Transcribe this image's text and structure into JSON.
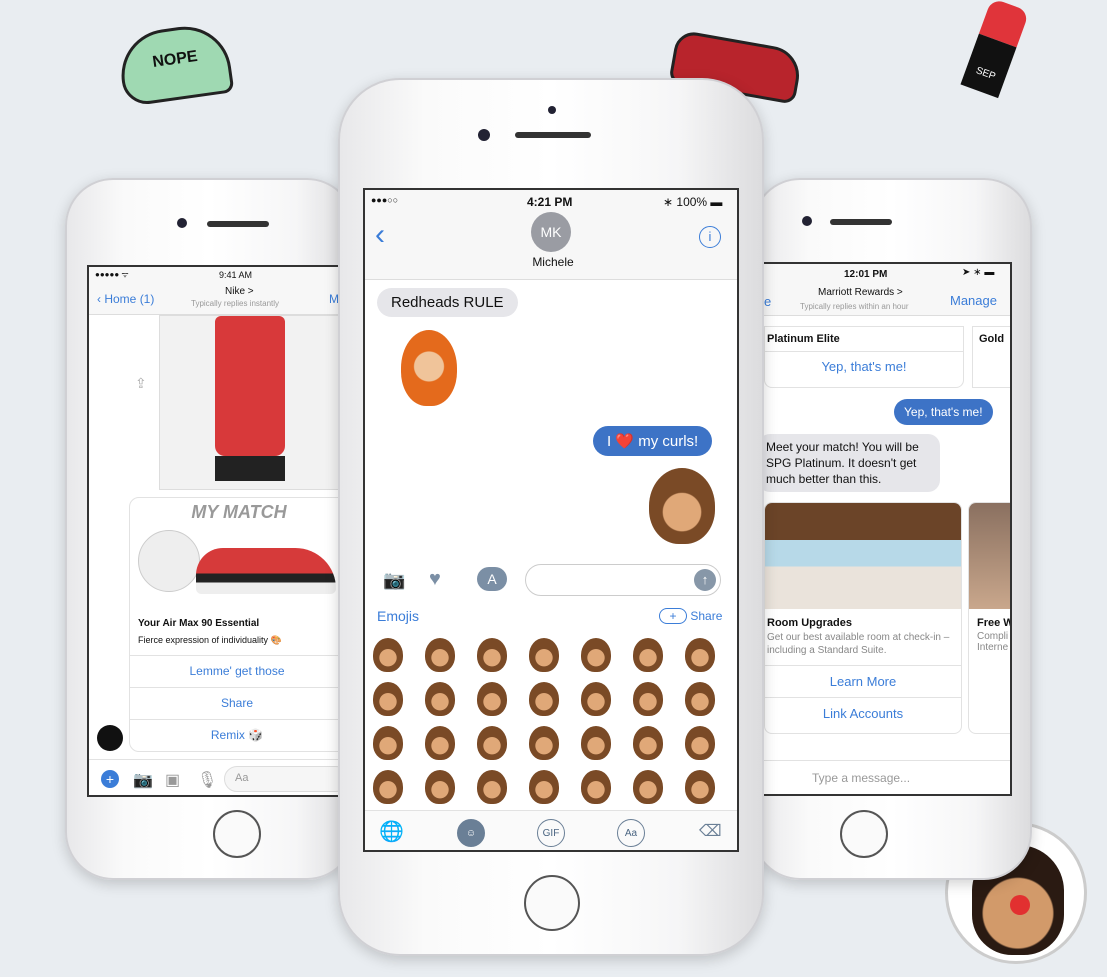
{
  "decor": {
    "cap_text": "NOPE",
    "lipstick_text": "SEP"
  },
  "left_phone": {
    "status": {
      "time": "9:41 AM"
    },
    "nav": {
      "back": "Home (1)",
      "title": "Nike >",
      "subtitle": "Typically replies instantly",
      "right": "M"
    },
    "card": {
      "header": "MY MATCH",
      "title": "Your Air Max 90 Essential",
      "subtitle": "Fierce expression of individuality 🎨",
      "buttons": [
        "Lemme' get those",
        "Share",
        "Remix 🎲"
      ]
    },
    "composer": {
      "placeholder": "Aa"
    }
  },
  "center_phone": {
    "status": {
      "signal": "●●●○○",
      "time": "4:21 PM",
      "battery": "100%"
    },
    "contact": {
      "initials": "MK",
      "name": "Michele"
    },
    "messages": [
      {
        "from": "them",
        "text": "Redheads RULE"
      },
      {
        "from": "me",
        "text_before": "I",
        "heart": "❤️",
        "text_after": "my curls!"
      }
    ],
    "drawer": {
      "label": "Emojis",
      "share": "Share"
    },
    "keyboard": {
      "gif": "GIF",
      "aa": "Aa"
    }
  },
  "right_phone": {
    "status": {
      "time": "12:01 PM"
    },
    "nav": {
      "back": "e",
      "title": "Marriott Rewards >",
      "subtitle": "Typically replies within an hour",
      "right": "Manage"
    },
    "options": [
      {
        "title": "Platinum Elite",
        "button": "Yep, that's me!"
      },
      {
        "title": "Gold"
      }
    ],
    "messages": [
      {
        "from": "me",
        "text": "Yep, that's me!"
      },
      {
        "from": "them",
        "text": "Meet your match! You will be SPG Platinum. It doesn't get much better than this."
      }
    ],
    "cards": [
      {
        "title": "Room Upgrades",
        "desc": "Get our best available room at check-in – including a Standard Suite.",
        "buttons": [
          "Learn More",
          "Link Accounts"
        ]
      },
      {
        "title": "Free W",
        "desc": "Compli Interne"
      }
    ],
    "composer": {
      "placeholder": "Type a message..."
    }
  },
  "colors": {
    "accent": "#3b7dd8",
    "my_bubble": "#3d73c6",
    "their_bubble": "#e6e6ea"
  }
}
